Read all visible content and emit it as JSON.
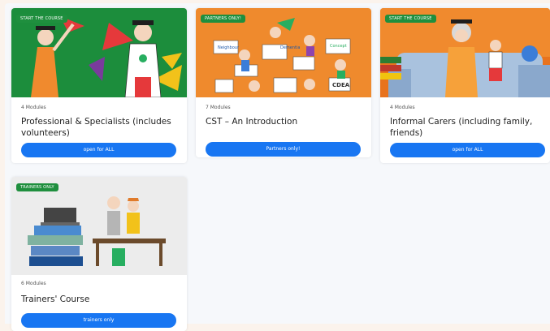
{
  "courses": [
    {
      "badge": "START THE COURSE",
      "modules": "4 Modules",
      "title": "Professional & Specialists (includes volunteers)",
      "button": "open for ALL",
      "illustration": "graduates-with-paper-plane"
    },
    {
      "badge": "PARTNERS ONLY!",
      "modules": "7 Modules",
      "title": "CST – An Introduction",
      "button": "Partners only!",
      "illustration": "partners-with-logo-signs",
      "signs": [
        "CDEA",
        "Dementia",
        "Concept",
        "Neighbour"
      ]
    },
    {
      "badge": "START THE COURSE",
      "modules": "4 Modules",
      "title": "Informal Carers (including family, friends)",
      "button": "open for ALL",
      "illustration": "family-carers-on-sofa"
    },
    {
      "badge": "TRAINERS ONLY",
      "modules": "6 Modules",
      "title": "Trainers' Course",
      "button": "trainers only",
      "illustration": "trainers-at-desk"
    }
  ],
  "colors": {
    "badge": "#1f8f3e",
    "button": "#1876f2",
    "thumb1_bg": "#1c8d3c",
    "thumb2_bg": "#ef8a2d",
    "thumb3_bg": "#e8731e",
    "thumb4_bg": "#ececec"
  }
}
